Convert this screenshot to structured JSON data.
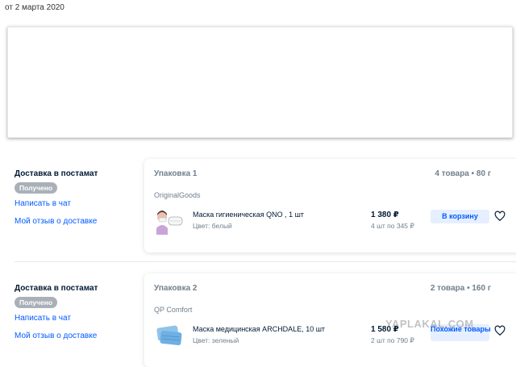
{
  "header": {
    "date": "от 2 марта 2020"
  },
  "orders": [
    {
      "delivery_title": "Доставка в постамат",
      "status": "Получено",
      "chat_link": "Написать в чат",
      "review_link": "Мой отзыв о доставке",
      "package_title": "Упаковка 1",
      "package_count": "4 товара • 80 г",
      "seller": "OriginalGoods",
      "item": {
        "name": "Маска гигиеническая QNO , 1 шт",
        "color": "Цвет: белый",
        "price": "1 380 ₽",
        "unit_price": "4 шт по 345 ₽",
        "button": "В корзину"
      }
    },
    {
      "delivery_title": "Доставка в постамат",
      "status": "Получено",
      "chat_link": "Написать в чат",
      "review_link": "Мой отзыв о доставке",
      "package_title": "Упаковка 2",
      "package_count": "2 товара • 160 г",
      "seller": "QP Comfort",
      "item": {
        "name": "Маска медицинская ARCHDALE, 10 шт",
        "color": "Цвет: зеленый",
        "price": "1 580 ₽",
        "unit_price": "2 шт по 790 ₽",
        "button": "Похожие товары"
      }
    }
  ],
  "watermark": "YAPLAKAL.COM",
  "colors": {
    "link": "#005bff",
    "badge": "#aab0b8",
    "button_bg": "#e6efff",
    "muted": "#707f8d"
  }
}
